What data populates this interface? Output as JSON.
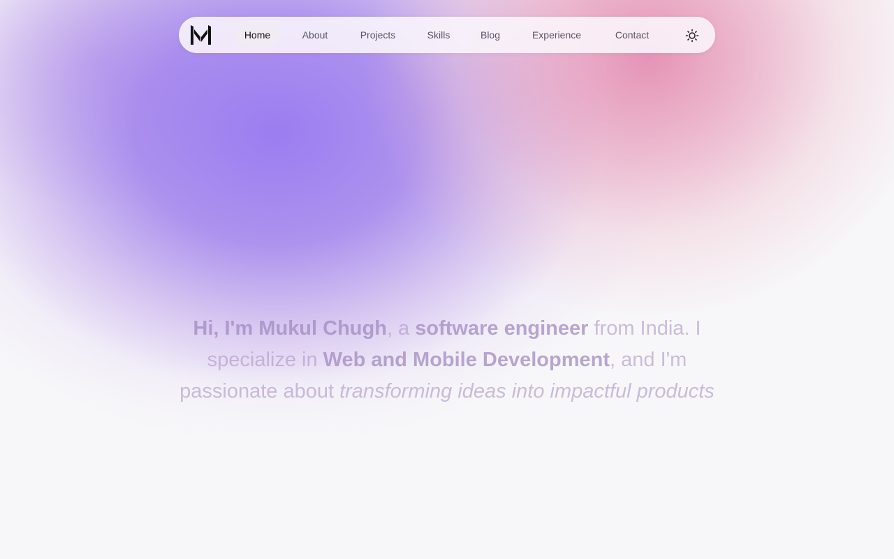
{
  "nav": {
    "logo": "M",
    "items": [
      {
        "label": "Home",
        "active": true
      },
      {
        "label": "About",
        "active": false
      },
      {
        "label": "Projects",
        "active": false
      },
      {
        "label": "Skills",
        "active": false
      },
      {
        "label": "Blog",
        "active": false
      },
      {
        "label": "Experience",
        "active": false
      },
      {
        "label": "Contact",
        "active": false
      }
    ],
    "theme_toggle_icon": "sun-icon"
  },
  "hero": {
    "greeting": "Hi, I'm ",
    "name": "Mukul Chugh",
    "text_1": ", a ",
    "role": "software engineer",
    "text_2": " from India. I specialize in ",
    "specialty": "Web and Mobile Development",
    "text_3": ", and I'm passionate about ",
    "passion": "transforming ideas into impactful products"
  },
  "colors": {
    "purple_blob": "#9a80ee",
    "pink_blob": "#e28aaa",
    "background": "#f7f7f9",
    "nav_active_bg": "#f1ecf3"
  }
}
